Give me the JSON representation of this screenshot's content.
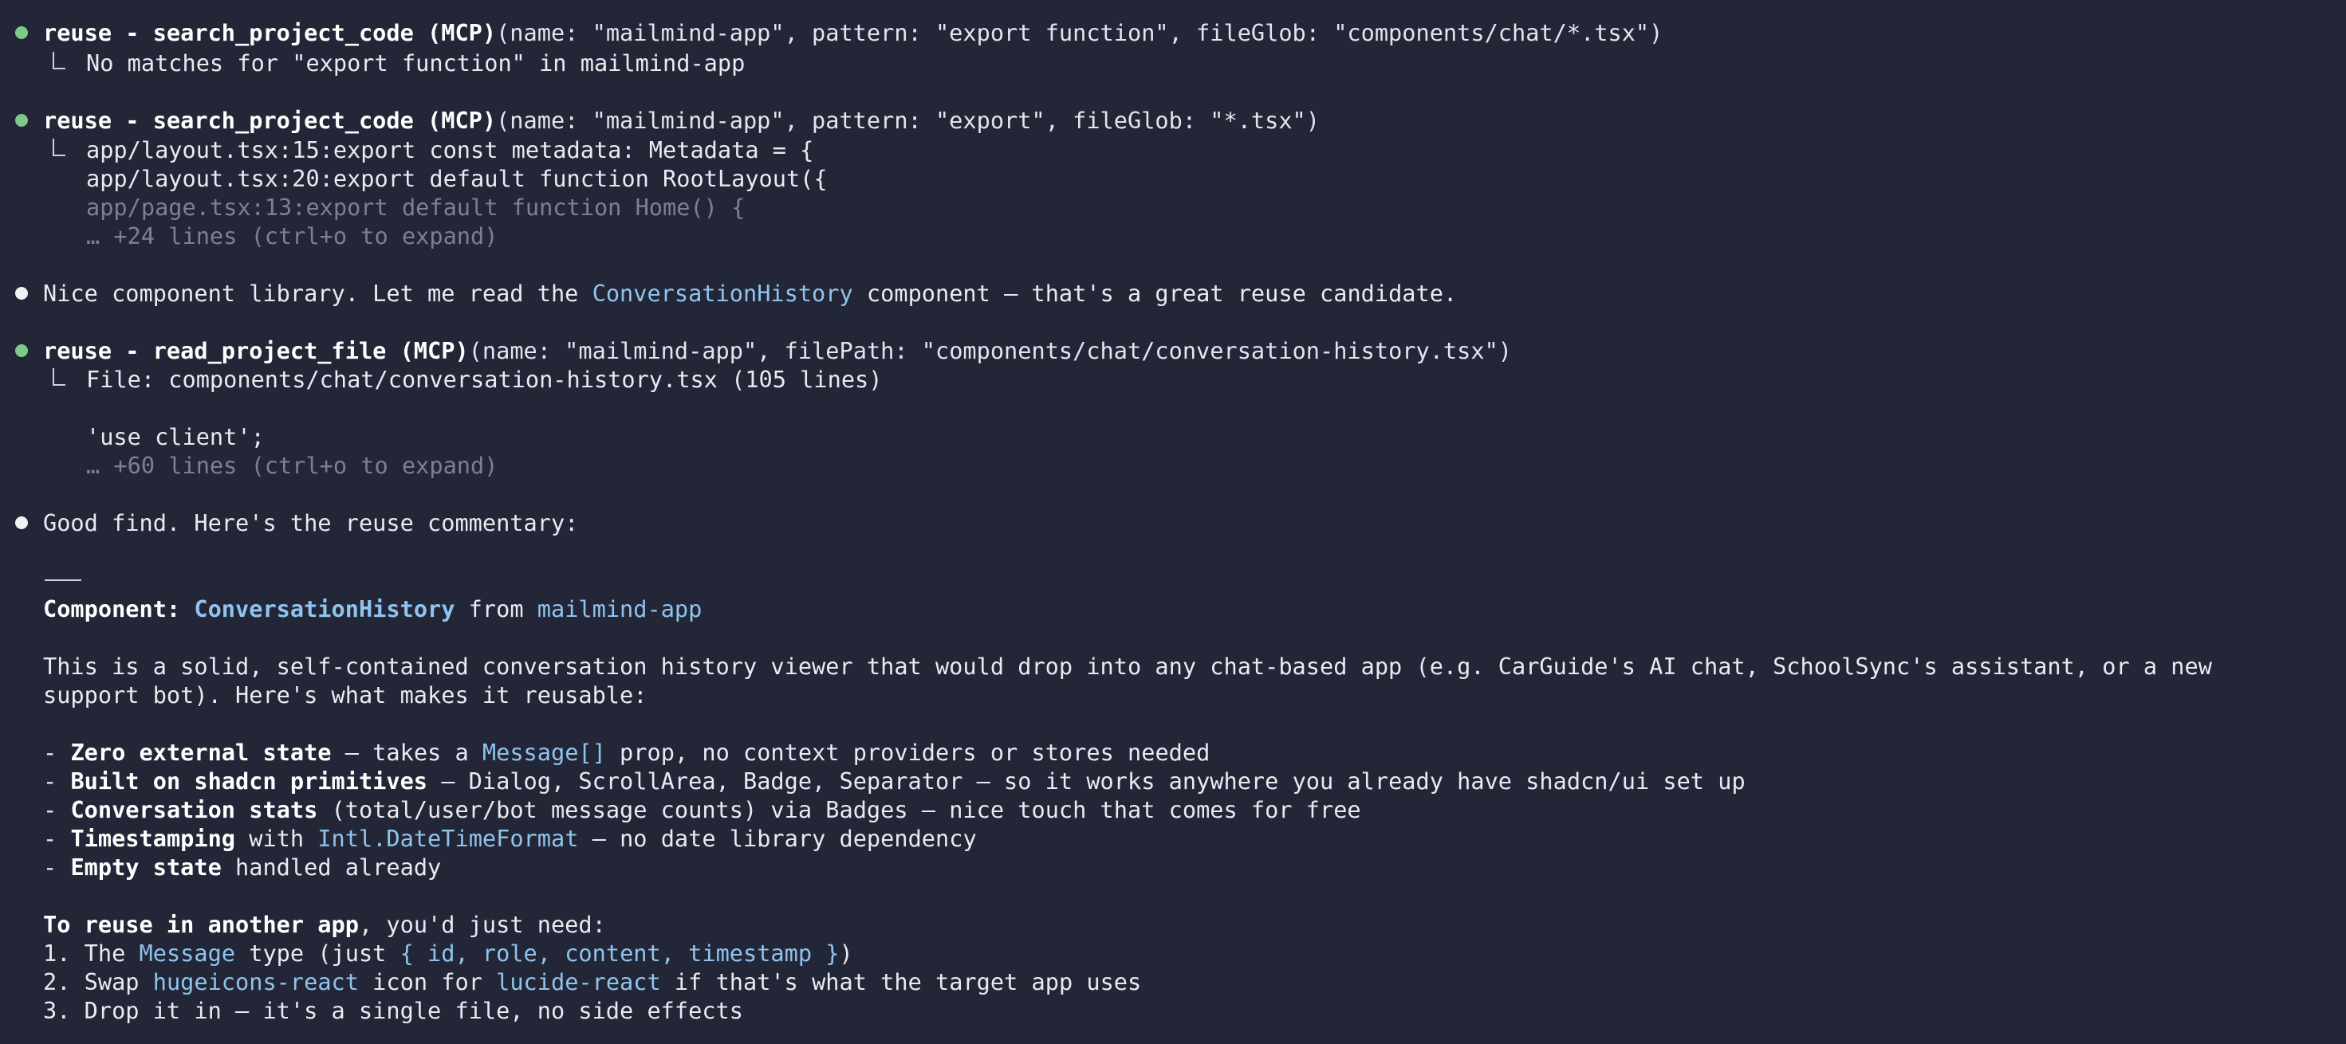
{
  "tool_calls": [
    {
      "title": "reuse - search_project_code (MCP)",
      "args": "(name: \"mailmind-app\", pattern: \"export function\", fileGlob: \"components/chat/*.tsx\")",
      "result_lines": [
        "No matches for \"export function\" in mailmind-app"
      ]
    },
    {
      "title": "reuse - search_project_code (MCP)",
      "args": "(name: \"mailmind-app\", pattern: \"export\", fileGlob: \"*.tsx\")",
      "result_lines": [
        "app/layout.tsx:15:export const metadata: Metadata = {",
        "app/layout.tsx:20:export default function RootLayout({",
        "app/page.tsx:13:export default function Home() {"
      ],
      "more": "… +24 lines (ctrl+o to expand)"
    },
    {
      "title": "reuse - read_project_file (MCP)",
      "args": "(name: \"mailmind-app\", filePath: \"components/chat/conversation-history.tsx\")",
      "result_lines": [
        "File: components/chat/conversation-history.tsx (105 lines)",
        "",
        "'use client';"
      ],
      "more": "… +60 lines (ctrl+o to expand)"
    }
  ],
  "messages": {
    "nice": {
      "before": "Nice component library. Let me read the ",
      "highlight": "ConversationHistory",
      "after": " component — that's a great reuse candidate."
    },
    "good_find": "Good find. Here's the reuse commentary:"
  },
  "commentary": {
    "rule": "———",
    "heading": {
      "label": "Component:",
      "name": "ConversationHistory",
      "from": " from ",
      "app": "mailmind-app"
    },
    "intro_1": "This is a solid, self-contained conversation history viewer that would drop into any chat-based app (e.g. CarGuide's AI chat, SchoolSync's assistant, or a new",
    "intro_2": "support bot). Here's what makes it reusable:",
    "bullets": [
      {
        "prefix": "- ",
        "bold": "Zero external state",
        "t1": " — takes a ",
        "code": "Message[]",
        "t2": " prop, no context providers or stores needed"
      },
      {
        "prefix": "- ",
        "bold": "Built on shadcn primitives",
        "t1": " — Dialog, ScrollArea, Badge, Separator — so it works anywhere you already have shadcn/ui set up"
      },
      {
        "prefix": "- ",
        "bold": "Conversation stats",
        "t1": " (total/user/bot message counts) via Badges — nice touch that comes for free"
      },
      {
        "prefix": "- ",
        "bold": "Timestamping",
        "t1": " with ",
        "code": "Intl.DateTimeFormat",
        "t2": " — no date library dependency"
      },
      {
        "prefix": "- ",
        "bold": "Empty state",
        "t1": " handled already"
      }
    ],
    "reuse_heading": {
      "bold": "To reuse in another app",
      "rest": ", you'd just need:"
    },
    "steps": [
      {
        "prefix": "1. The ",
        "code1": "Message",
        "t1": " type (just ",
        "code2": "{ id, role, content, timestamp }",
        "t2": ")"
      },
      {
        "prefix": "2. Swap ",
        "code1": "hugeicons-react",
        "t1": " icon for ",
        "code2": "lucide-react",
        "t2": " if that's what the target app uses"
      },
      {
        "prefix": "3. Drop it in — it's a single file, no side effects"
      }
    ]
  },
  "colors": {
    "background": "#232637",
    "text": "#eaeaf0",
    "highlight": "#8fc4ee",
    "dim": "#7c8092",
    "tool_dot": "#7fc98a",
    "message_dot": "#f1f1f4"
  }
}
